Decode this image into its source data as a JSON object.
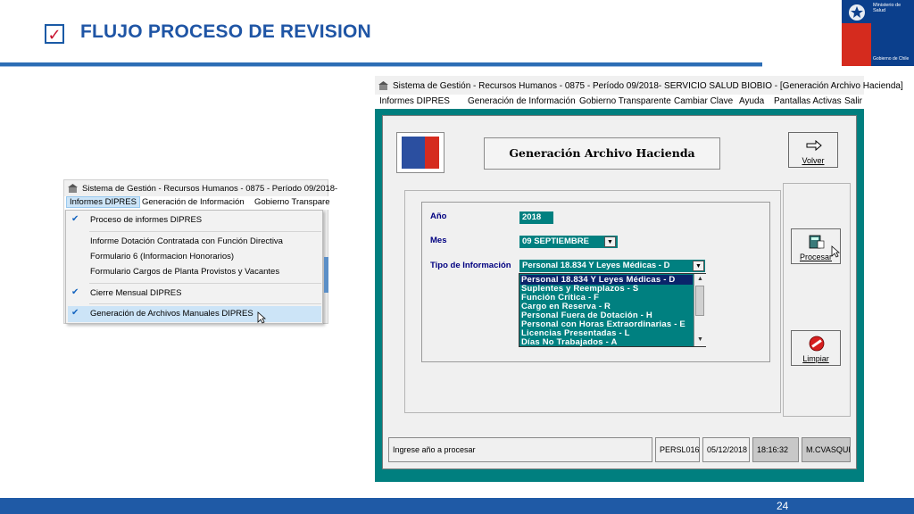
{
  "slide": {
    "title": "FLUJO PROCESO DE REVISION",
    "check_glyph": "✓",
    "page_number": "24",
    "gov_logo": {
      "line1": "Ministerio de Salud",
      "footer": "Gobierno de Chile"
    }
  },
  "menu_screenshot": {
    "window_title": "Sistema de Gestión - Recursos Humanos - 0875 - Período 09/2018-",
    "menubar": [
      "Informes DIPRES",
      "Generación de Información",
      "Gobierno Transpare"
    ],
    "items": [
      {
        "label": "Proceso de informes DIPRES",
        "checked": true
      },
      {
        "label": "Informe Dotación Contratada con Función Directiva",
        "checked": false
      },
      {
        "label": "Formulario 6 (Informacion Honorarios)",
        "checked": false
      },
      {
        "label": "Formulario Cargos de Planta Provistos y Vacantes",
        "checked": false
      },
      {
        "label": "Cierre Mensual DIPRES",
        "checked": true
      },
      {
        "label": "Generación de Archivos Manuales DIPRES",
        "checked": true
      }
    ]
  },
  "app_window": {
    "title": "Sistema de Gestión - Recursos Humanos - 0875 - Período 09/2018- SERVICIO SALUD BIOBIO - [Generación Archivo Hacienda]",
    "menubar": [
      "Informes DIPRES",
      "Generación de Información",
      "Gobierno Transparente",
      "Cambiar Clave",
      "Ayuda",
      "Pantallas Activas",
      "Salir"
    ],
    "heading": "Generación Archivo Hacienda",
    "buttons": {
      "volver": "Volver",
      "procesar": "Procesar",
      "limpiar": "Limpiar"
    },
    "form": {
      "anio_label": "Año",
      "anio_value": "2018",
      "mes_label": "Mes",
      "mes_value": "09 SEPTIEMBRE",
      "tipo_label": "Tipo de Información",
      "tipo_value": "Personal 18.834 Y Leyes Médicas - D",
      "tipo_options": [
        "Personal 18.834 Y Leyes Médicas - D",
        "Suplentes y Reemplazos - S",
        "Función Crítica - F",
        "Cargo en Reserva - R",
        "Personal Fuera de Dotación - H",
        "Personal con Horas Extraordinarias - E",
        "Licencias Presentadas - L",
        "Días No Trabajados - A"
      ]
    },
    "status": {
      "message": "Ingrese año a procesar",
      "program": "PERSL016",
      "date": "05/12/2018",
      "time": "18:16:32",
      "user": "M.CVASQUE"
    }
  },
  "colors": {
    "accent": "#1f55a5",
    "teal": "#008080",
    "gov_blue": "#0b3f8c",
    "gov_red": "#d52b1e"
  }
}
